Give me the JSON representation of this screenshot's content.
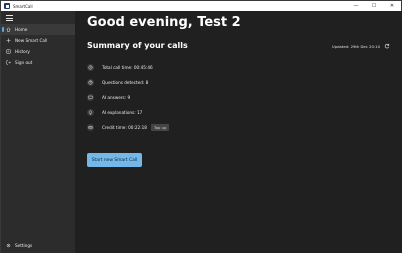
{
  "window": {
    "title": "SmartCall",
    "controls": {
      "minimize": "—",
      "maximize": "☐",
      "close": "✕"
    }
  },
  "sidebar": {
    "items": [
      {
        "label": "Home",
        "icon": "home-icon",
        "active": true
      },
      {
        "label": "New Smart Call",
        "icon": "plus-icon"
      },
      {
        "label": "History",
        "icon": "history-icon"
      },
      {
        "label": "Sign out",
        "icon": "sign-out-icon"
      }
    ],
    "settings_label": "Settings"
  },
  "main": {
    "greeting": "Good evening, Test 2",
    "summary_title": "Summary of your calls",
    "updated": "Updated: 29th Dec 20:10",
    "stats": {
      "total_call_time": "Total call time: 00:45:46",
      "questions_detected": "Questions detected: 8",
      "ai_answers": "AI answers: 9",
      "ai_explanations": "AI explanations: 17",
      "credit_time": "Credit time: 00:22:18"
    },
    "topup_label": "Top up",
    "start_button": "Start new Smart Call"
  },
  "colors": {
    "accent": "#74b8ea",
    "sidebar_bg": "#2c2c2c",
    "main_bg": "#202020"
  }
}
